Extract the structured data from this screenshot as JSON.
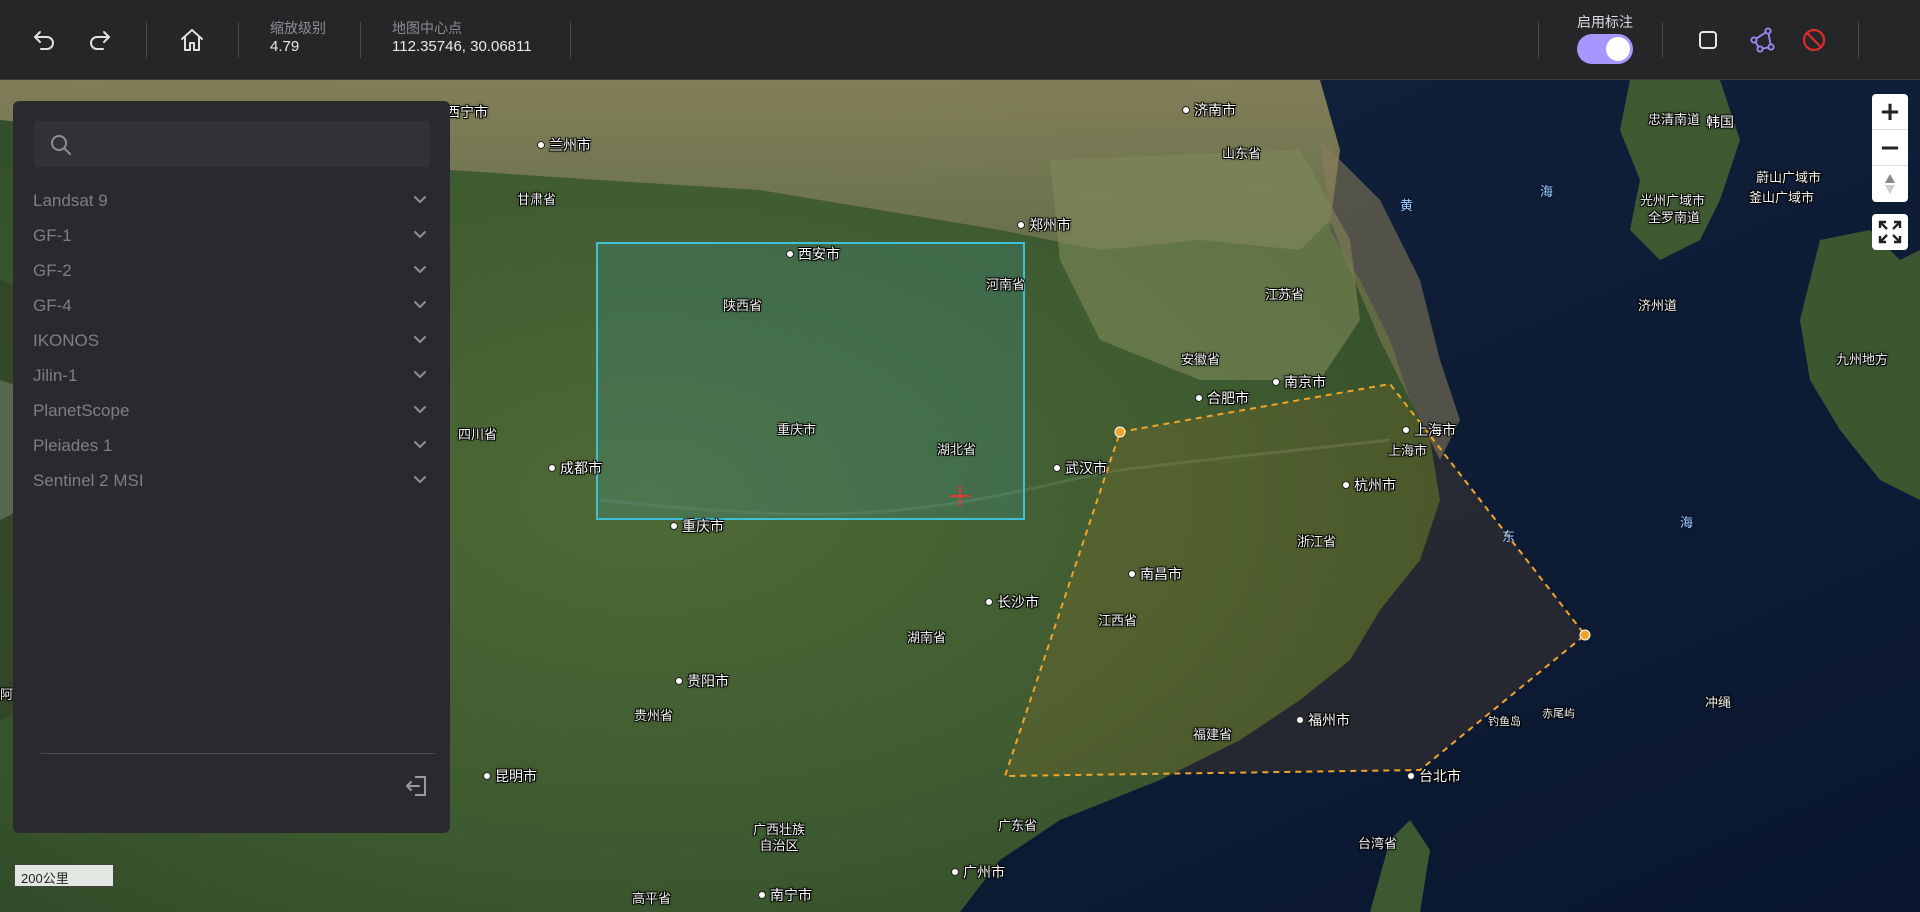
{
  "toolbar": {
    "undo_icon": "undo-icon",
    "redo_icon": "redo-icon",
    "home_icon": "home-icon",
    "zoom_label": "缩放级别",
    "zoom_value": "4.79",
    "center_label": "地图中心点",
    "center_value": "112.35746, 30.06811",
    "annotation_label": "启用标注",
    "annotation_enabled": true,
    "accent": "#a896ff"
  },
  "sidebar": {
    "search_placeholder": "",
    "items": [
      {
        "label": "Landsat 9"
      },
      {
        "label": "GF-1"
      },
      {
        "label": "GF-2"
      },
      {
        "label": "GF-4"
      },
      {
        "label": "IKONOS"
      },
      {
        "label": "Jilin-1"
      },
      {
        "label": "PlanetScope"
      },
      {
        "label": "Pleiades 1"
      },
      {
        "label": "Sentinel 2 MSI"
      }
    ]
  },
  "map": {
    "scale": "200公里",
    "labels": {
      "xining": "西宁市",
      "lanzhou": "兰州市",
      "gansu": "甘肃省",
      "jinan": "济南市",
      "shandong": "山东省",
      "zhengzhou": "郑州市",
      "xian": "西安市",
      "henan": "河南省",
      "shaanxi": "陕西省",
      "jiangsu": "江苏省",
      "anhui": "安徽省",
      "hefei": "合肥市",
      "nanjing": "南京市",
      "shanghai1": "上海市",
      "shanghai2": "上海市",
      "hangzhou": "杭州市",
      "zhejiang": "浙江省",
      "sichuan": "四川省",
      "chengdu": "成都市",
      "chongqing1": "重庆市",
      "chongqing2": "重庆市",
      "hubei": "湖北省",
      "wuhan": "武汉市",
      "nanchang": "南昌市",
      "jiangxi": "江西省",
      "changsha": "长沙市",
      "hunan": "湖南省",
      "guiyang": "贵阳市",
      "guizhou": "贵州省",
      "fuzhou": "福州市",
      "fujian": "福建省",
      "taibei": "台北市",
      "taiwan": "台湾省",
      "kunming": "昆明市",
      "guangxi": "广西壮族\n自治区",
      "guangdong": "广东省",
      "guangzhou": "广州市",
      "nanning": "南宁市",
      "gaoping": "高平省",
      "korea1": "忠清南道",
      "korea": "韩国",
      "gwangju": "光州广域市",
      "jeolla": "全罗南道",
      "ulsan": "蔚山广域市",
      "busan": "釜山广域市",
      "jeju": "济州道",
      "kyushu": "九州地方",
      "okinawa": "冲绳",
      "diaoyu": "钓鱼岛",
      "chiwei": "赤尾屿",
      "sea1": "黄",
      "sea2": "海",
      "sea3": "东",
      "sea4": "海",
      "edge_a": "阿"
    }
  },
  "controls": {
    "zoom_in": "+",
    "zoom_out": "−",
    "compass": "compass-icon",
    "fullscreen": "fullscreen-icon"
  },
  "colors": {
    "rect_stroke": "#3fc0d8",
    "polygon_stroke": "#f0a52a"
  }
}
